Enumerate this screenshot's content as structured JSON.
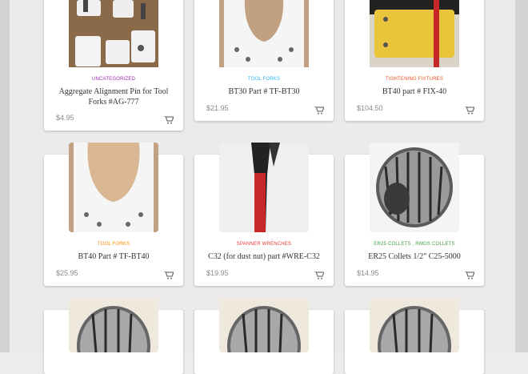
{
  "products": [
    {
      "category": "UNCATEGORIZED",
      "category_color": "#9c27b0",
      "title": "Aggregate Alignment Pin for Tool Forks #AG-777",
      "price": "$4.95",
      "image": "white-pin-blocks"
    },
    {
      "category": "TOOL FORKS",
      "category_color": "#29b6f6",
      "title": "BT30 Part # TF-BT30",
      "price": "$21.95",
      "image": "white-fork-plate"
    },
    {
      "category": "TIGHTENING FIXTURES",
      "category_color": "#f4511e",
      "title": "BT40 part # FIX-40",
      "price": "$104.50",
      "image": "yellow-fixture"
    },
    {
      "category": "TOOL FORKS",
      "category_color": "#fb8c00",
      "title": "BT40 Part # TF-BT40",
      "price": "$25.95",
      "image": "white-fork-plate"
    },
    {
      "category": "SPANNER WRENCHES",
      "category_color": "#e53935",
      "title": "C32 (for dust nut) part #WRE-C32",
      "price": "$19.95",
      "image": "red-wrench"
    },
    {
      "category": "ER25 COLLETS , RMOS COLLETS",
      "category_color": "#43a047",
      "title": "ER25 Collets 1/2\" C25-5000",
      "price": "$14.95",
      "image": "collet"
    },
    {
      "category": "",
      "category_color": "",
      "title": "",
      "price": "",
      "image": "collet"
    },
    {
      "category": "",
      "category_color": "",
      "title": "",
      "price": "",
      "image": "collet"
    },
    {
      "category": "",
      "category_color": "",
      "title": "",
      "price": "",
      "image": "collet"
    }
  ],
  "icons": {
    "cart": "cart-icon"
  }
}
